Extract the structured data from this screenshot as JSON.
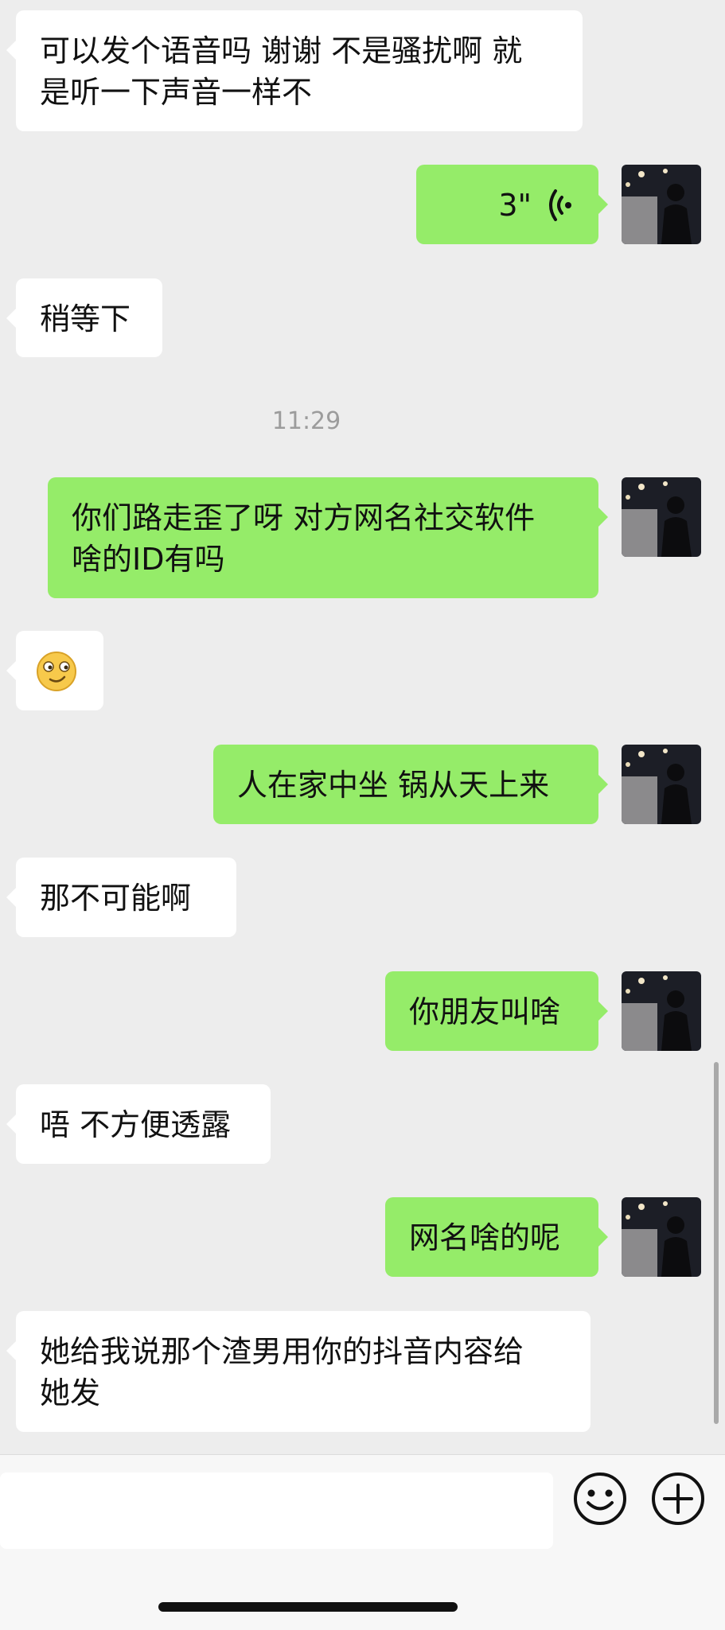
{
  "messages": [
    {
      "id": 1,
      "dir": "in",
      "lines": [
        "可以发个语音吗 谢谢 不是骚扰啊 就",
        "是听一下声音一样不"
      ]
    },
    {
      "id": 2,
      "dir": "out",
      "type": "voice",
      "duration": "3\""
    },
    {
      "id": 3,
      "dir": "in",
      "lines": [
        "稍等下"
      ]
    },
    {
      "timestamp": "11:29"
    },
    {
      "id": 4,
      "dir": "out",
      "lines": [
        "你们路走歪了呀 对方网名社交软件",
        "啥的ID有吗"
      ]
    },
    {
      "id": 5,
      "dir": "in",
      "type": "emoji",
      "emoji": "smirk-face-icon"
    },
    {
      "id": 6,
      "dir": "out",
      "lines": [
        "人在家中坐 锅从天上来"
      ]
    },
    {
      "id": 7,
      "dir": "in",
      "lines": [
        "那不可能啊"
      ]
    },
    {
      "id": 8,
      "dir": "out",
      "lines": [
        "你朋友叫啥"
      ]
    },
    {
      "id": 9,
      "dir": "in",
      "lines": [
        "唔 不方便透露"
      ]
    },
    {
      "id": 10,
      "dir": "out",
      "lines": [
        "网名啥的呢"
      ]
    },
    {
      "id": 11,
      "dir": "in",
      "lines": [
        "她给我说那个渣男用你的抖音内容给",
        "她发"
      ]
    }
  ],
  "input_bar": {
    "emoji_button_icon": "smiley-icon",
    "plus_button_icon": "plus-icon"
  },
  "colors": {
    "background": "#ededed",
    "incoming_bubble": "#ffffff",
    "outgoing_bubble": "#95ec69",
    "timestamp": "#9c9c9c"
  }
}
